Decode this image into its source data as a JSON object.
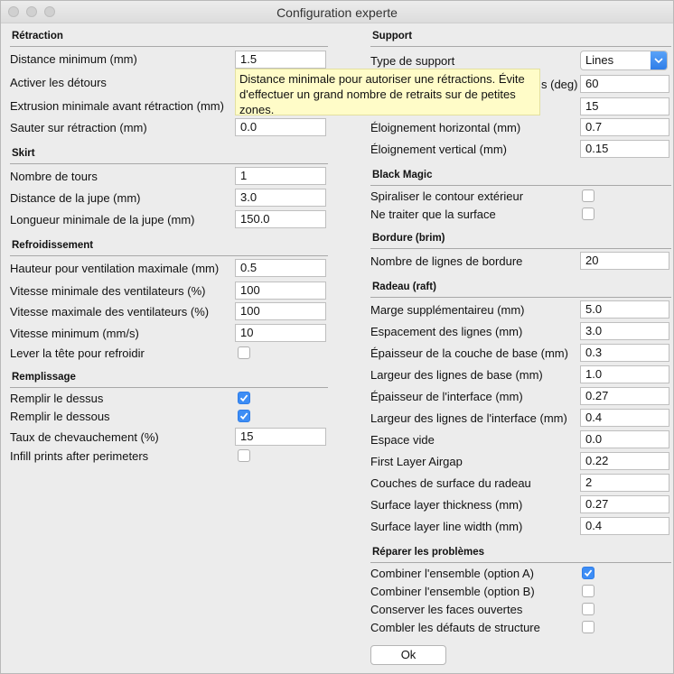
{
  "window": {
    "title": "Configuration experte"
  },
  "left": {
    "retraction": {
      "title": "Rétraction",
      "min_distance_label": "Distance minimum (mm)",
      "min_distance_value": "1.5",
      "detours_label": "Activer les détours",
      "min_extrusion_label": "Extrusion minimale avant rétraction (mm)",
      "skip_label": "Sauter sur rétraction (mm)",
      "skip_value": "0.0"
    },
    "skirt": {
      "title": "Skirt",
      "loops_label": "Nombre de tours",
      "loops_value": "1",
      "distance_label": "Distance de la jupe (mm)",
      "distance_value": "3.0",
      "min_length_label": "Longueur minimale de la jupe (mm)",
      "min_length_value": "150.0"
    },
    "cooling": {
      "title": "Refroidissement",
      "fan_height_label": "Hauteur pour ventilation maximale (mm)",
      "fan_height_value": "0.5",
      "fan_min_label": "Vitesse minimale des ventilateurs (%)",
      "fan_min_value": "100",
      "fan_max_label": "Vitesse maximale des ventilateurs (%)",
      "fan_max_value": "100",
      "min_speed_label": "Vitesse minimum (mm/s)",
      "min_speed_value": "10",
      "lift_head_label": "Lever la tête pour refroidir"
    },
    "infill": {
      "title": "Remplissage",
      "fill_top_label": "Remplir le dessus",
      "fill_bottom_label": "Remplir le dessous",
      "overlap_label": "Taux de chevauchement (%)",
      "overlap_value": "15",
      "after_perimeters_label": "Infill prints after perimeters"
    }
  },
  "right": {
    "support": {
      "title": "Support",
      "type_label": "Type de support",
      "type_value": "Lines",
      "angle_label_partial": "s (deg)",
      "angle_value": "60",
      "fill_value": "15",
      "xy_distance_label": "Éloignement horizontal (mm)",
      "xy_distance_value": "0.7",
      "z_distance_label": "Éloignement vertical (mm)",
      "z_distance_value": "0.15"
    },
    "black_magic": {
      "title": "Black Magic",
      "spiralize_label": "Spiraliser le contour extérieur",
      "surface_only_label": "Ne traiter que la surface"
    },
    "brim": {
      "title": "Bordure (brim)",
      "lines_label": "Nombre de lignes de bordure",
      "lines_value": "20"
    },
    "raft": {
      "title": "Radeau (raft)",
      "margin_label": "Marge supplémentaireu (mm)",
      "margin_value": "5.0",
      "line_spacing_label": "Espacement des lignes (mm)",
      "line_spacing_value": "3.0",
      "base_thickness_label": "Épaisseur de la couche de base (mm)",
      "base_thickness_value": "0.3",
      "base_width_label": "Largeur des lignes de base (mm)",
      "base_width_value": "1.0",
      "interface_thickness_label": "Épaisseur de l'interface (mm)",
      "interface_thickness_value": "0.27",
      "interface_width_label": "Largeur des lignes de l'interface (mm)",
      "interface_width_value": "0.4",
      "airgap_label": "Espace vide",
      "airgap_value": "0.0",
      "first_airgap_label": "First Layer Airgap",
      "first_airgap_value": "0.22",
      "surface_layers_label": "Couches de surface du radeau",
      "surface_layers_value": "2",
      "surface_thickness_label": "Surface layer thickness (mm)",
      "surface_thickness_value": "0.27",
      "surface_width_label": "Surface layer line width (mm)",
      "surface_width_value": "0.4"
    },
    "fix": {
      "title": "Réparer les problèmes",
      "combine_a_label": "Combiner l'ensemble (option A)",
      "combine_b_label": "Combiner l'ensemble (option B)",
      "keep_open_label": "Conserver les faces ouvertes",
      "extensive_label": "Combler les défauts de structure"
    },
    "ok_label": "Ok"
  },
  "tooltip": {
    "line1": "Distance minimale pour autoriser une rétractions. Évite",
    "line2": "d'effectuer un grand nombre de retraits sur de petites",
    "line3": "zones."
  },
  "colors": {
    "accent": "#3d8df5",
    "tooltip_bg": "#fffcc8",
    "window_bg": "#ececec"
  }
}
